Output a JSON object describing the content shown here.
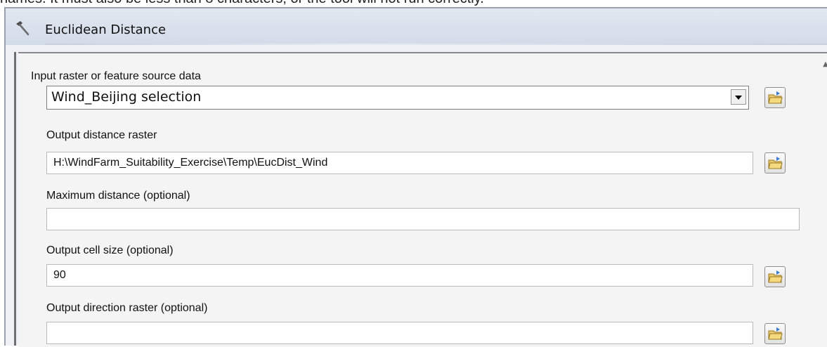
{
  "caption": "names. It must also be less than 8 characters, or the tool will not run correctly.",
  "window": {
    "title": "Euclidean Distance"
  },
  "fields": {
    "input_source": {
      "label": "Input raster or feature source data",
      "value": "Wind_Beijing selection"
    },
    "output_distance": {
      "label": "Output distance raster",
      "value": "H:\\WindFarm_Suitability_Exercise\\Temp\\EucDist_Wind"
    },
    "max_distance": {
      "label": "Maximum distance (optional)",
      "value": ""
    },
    "cell_size": {
      "label": "Output cell size (optional)",
      "value": "90"
    },
    "output_direction": {
      "label": "Output direction raster (optional)",
      "value": ""
    }
  },
  "icons": {
    "tool": "hammer-icon",
    "browse": "folder-open-icon",
    "dropdown": "chevron-down-icon"
  },
  "colors": {
    "panel": "#f4f4f4",
    "titlebar": "#dae1ec",
    "field_border": "#b9b9b9"
  }
}
